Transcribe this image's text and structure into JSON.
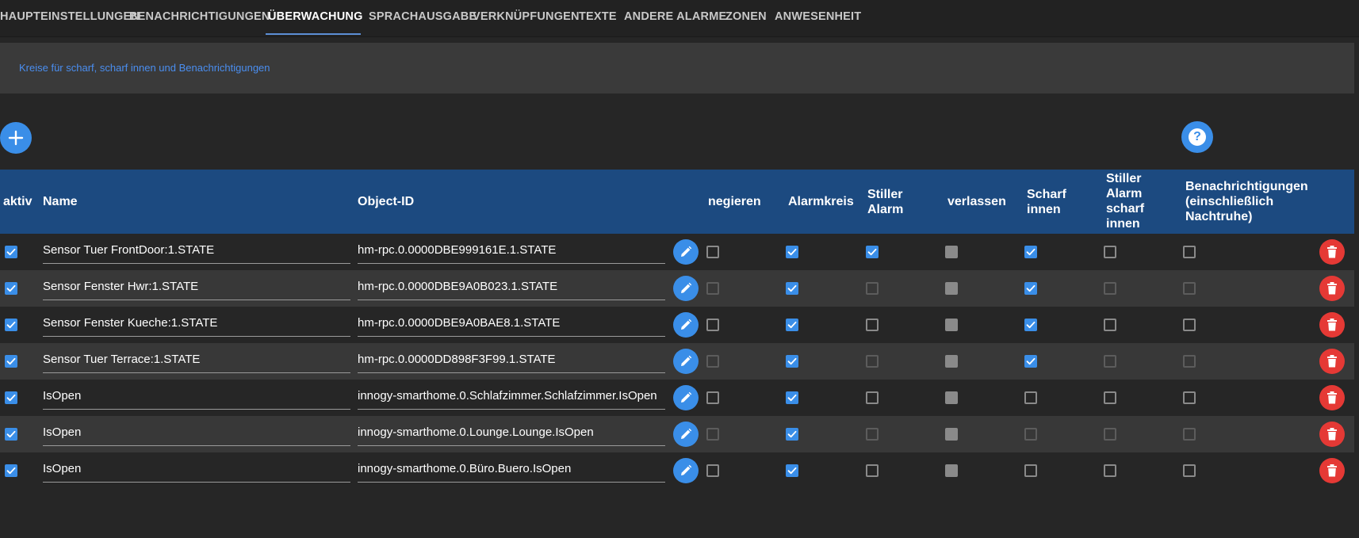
{
  "tabs": [
    {
      "label": "HAUPTEINSTELLUNGEN"
    },
    {
      "label": "BENACHRICHTIGUNGEN"
    },
    {
      "label": "ÜBERWACHUNG"
    },
    {
      "label": "SPRACHAUSGABE"
    },
    {
      "label": "VERKNÜPFUNGEN"
    },
    {
      "label": "TEXTE"
    },
    {
      "label": "ANDERE ALARME"
    },
    {
      "label": "ZONEN"
    },
    {
      "label": "ANWESENHEIT"
    }
  ],
  "active_tab": "ÜBERWACHUNG",
  "info": {
    "text": "Kreise für scharf, scharf innen und Benachrichtigungen"
  },
  "buttons": {
    "add_icon": "plus-icon",
    "help_icon": "question-icon"
  },
  "table": {
    "headers": {
      "aktiv": "aktiv",
      "name": "Name",
      "object_id": "Object-ID",
      "negieren": "negieren",
      "alarmkreis": "Alarmkreis",
      "stiller_alarm_1": "Stiller",
      "stiller_alarm_2": "Alarm",
      "verlassen": "verlassen",
      "scharf_innen_1": "Scharf",
      "scharf_innen_2": "innen",
      "stiller_scharf_1": "Stiller",
      "stiller_scharf_2": "Alarm",
      "stiller_scharf_3": "scharf",
      "stiller_scharf_4": "innen",
      "benach_1": "Benachrichtigungen",
      "benach_2": "(einschließlich",
      "benach_3": "Nachtruhe)"
    },
    "rows": [
      {
        "aktiv": true,
        "name": "Sensor Tuer FrontDoor:1.STATE",
        "object_id": "hm-rpc.0.0000DBE999161E.1.STATE",
        "negieren": false,
        "alarmkreis": true,
        "stiller_alarm": true,
        "verlassen": true,
        "scharf_innen": true,
        "stiller_alarm_scharf_innen": false,
        "benachrichtigungen": false
      },
      {
        "aktiv": true,
        "name": "Sensor Fenster Hwr:1.STATE",
        "object_id": "hm-rpc.0.0000DBE9A0B023.1.STATE",
        "negieren": false,
        "alarmkreis": true,
        "stiller_alarm": false,
        "verlassen": true,
        "scharf_innen": true,
        "stiller_alarm_scharf_innen": false,
        "benachrichtigungen": false
      },
      {
        "aktiv": true,
        "name": "Sensor Fenster Kueche:1.STATE",
        "object_id": "hm-rpc.0.0000DBE9A0BAE8.1.STATE",
        "negieren": false,
        "alarmkreis": true,
        "stiller_alarm": false,
        "verlassen": true,
        "scharf_innen": true,
        "stiller_alarm_scharf_innen": false,
        "benachrichtigungen": false
      },
      {
        "aktiv": true,
        "name": "Sensor Tuer Terrace:1.STATE",
        "object_id": "hm-rpc.0.0000DD898F3F99.1.STATE",
        "negieren": false,
        "alarmkreis": true,
        "stiller_alarm": false,
        "verlassen": true,
        "scharf_innen": true,
        "stiller_alarm_scharf_innen": false,
        "benachrichtigungen": false
      },
      {
        "aktiv": true,
        "name": "IsOpen",
        "object_id": "innogy-smarthome.0.Schlafzimmer.Schlafzimmer.IsOpen",
        "negieren": false,
        "alarmkreis": true,
        "stiller_alarm": false,
        "verlassen": true,
        "scharf_innen": false,
        "stiller_alarm_scharf_innen": false,
        "benachrichtigungen": false
      },
      {
        "aktiv": true,
        "name": "IsOpen",
        "object_id": "innogy-smarthome.0.Lounge.Lounge.IsOpen",
        "negieren": false,
        "alarmkreis": true,
        "stiller_alarm": false,
        "verlassen": true,
        "scharf_innen": false,
        "stiller_alarm_scharf_innen": false,
        "benachrichtigungen": false
      },
      {
        "aktiv": true,
        "name": "IsOpen",
        "object_id": "innogy-smarthome.0.Büro.Buero.IsOpen",
        "negieren": false,
        "alarmkreis": true,
        "stiller_alarm": false,
        "verlassen": true,
        "scharf_innen": false,
        "stiller_alarm_scharf_innen": false,
        "benachrichtigungen": false
      }
    ],
    "row_icons": {
      "edit": "pencil-icon",
      "delete": "trash-icon"
    }
  },
  "colors": {
    "accent": "#3a8ee8",
    "header": "#1c4a80",
    "danger": "#e53935",
    "info_text": "#4a8ef0"
  }
}
